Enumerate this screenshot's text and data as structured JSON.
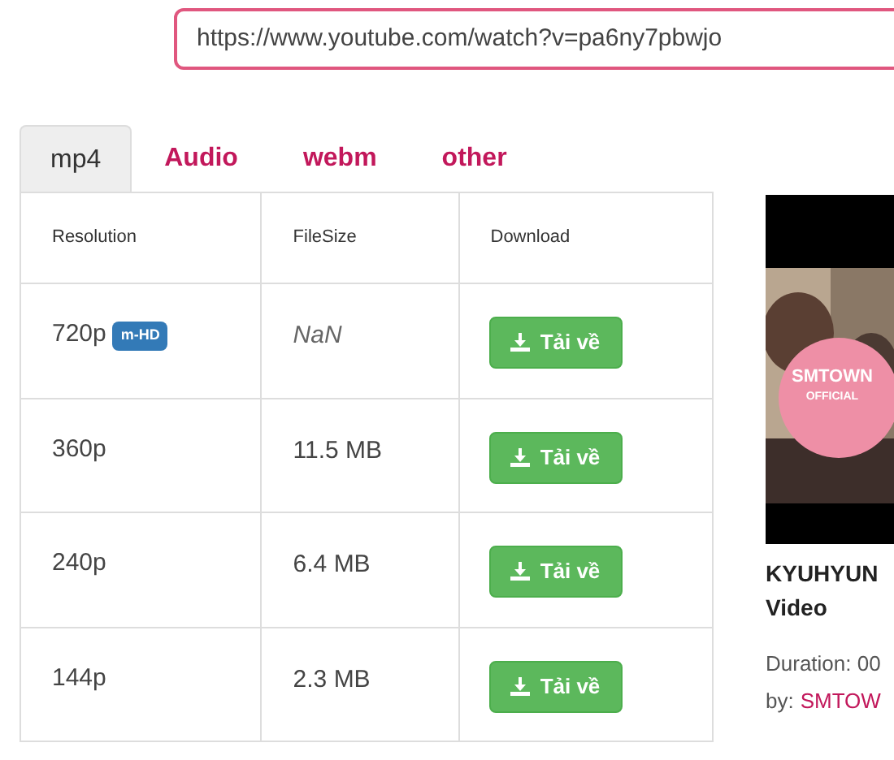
{
  "url_field": {
    "value": "https://www.youtube.com/watch?v=pa6ny7pbwjo"
  },
  "tabs": [
    {
      "label": "mp4",
      "selected": true
    },
    {
      "label": "Audio",
      "selected": false
    },
    {
      "label": "webm",
      "selected": false
    },
    {
      "label": "other",
      "selected": false
    }
  ],
  "table": {
    "columns": [
      "Resolution",
      "FileSize",
      "Download"
    ],
    "rows": [
      {
        "resolution": "720p",
        "badge": "m-HD",
        "filesize": "NaN",
        "filesize_unknown": true,
        "button": "Tải về"
      },
      {
        "resolution": "360p",
        "filesize": "11.5 MB",
        "filesize_unknown": false,
        "button": "Tải về"
      },
      {
        "resolution": "240p",
        "filesize": "6.4 MB",
        "filesize_unknown": false,
        "button": "Tải về"
      },
      {
        "resolution": "144p",
        "filesize": "2.3 MB",
        "filesize_unknown": false,
        "button": "Tải về"
      }
    ]
  },
  "video": {
    "thumbnail": {
      "kind": "picture"
    },
    "badge_title": "SMTOWN",
    "badge_subtitle": "OFFICIAL",
    "title_lines": [
      "KYUHYUN",
      "Video"
    ],
    "duration": "Duration: 00",
    "by_label": "by:",
    "channel": "SMTOW"
  }
}
